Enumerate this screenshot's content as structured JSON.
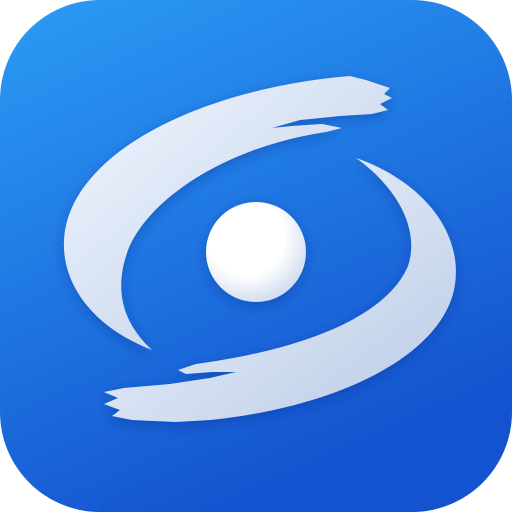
{
  "icon": {
    "name": "app-icon-swirl-eye",
    "colors": {
      "gradient_top": "#2b9cf5",
      "gradient_bottom": "#1453cf",
      "stroke_light": "#f3f7ff",
      "stroke_shade": "#b9cbe6",
      "ball_light": "#ffffff",
      "ball_shade": "#cdd9ee"
    }
  }
}
